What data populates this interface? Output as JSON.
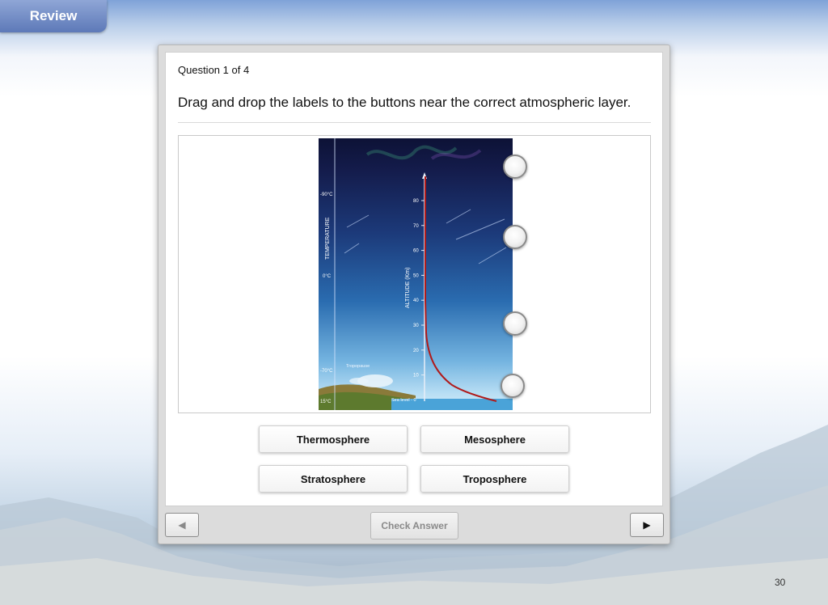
{
  "header": {
    "review_label": "Review"
  },
  "question": {
    "counter": "Question 1 of 4",
    "prompt": "Drag and drop the labels to the buttons near the correct atmospheric layer."
  },
  "diagram": {
    "temperature_axis_label": "TEMPERATURE",
    "altitude_axis_label": "ALTITUDE (Km)",
    "temperature_ticks": [
      "-90°C",
      "0°C",
      "-70°C",
      "15°C"
    ],
    "altitude_ticks": [
      "80",
      "70",
      "60",
      "50",
      "40",
      "30",
      "20",
      "10"
    ],
    "tropopause_label": "Tropopause",
    "sea_level_label": "Sea level - 0"
  },
  "labels": [
    {
      "text": "Thermosphere"
    },
    {
      "text": "Mesosphere"
    },
    {
      "text": "Stratosphere"
    },
    {
      "text": "Troposphere"
    }
  ],
  "footer": {
    "prev_icon": "◀",
    "next_icon": "▶",
    "check_label": "Check Answer"
  },
  "page_number": "30"
}
